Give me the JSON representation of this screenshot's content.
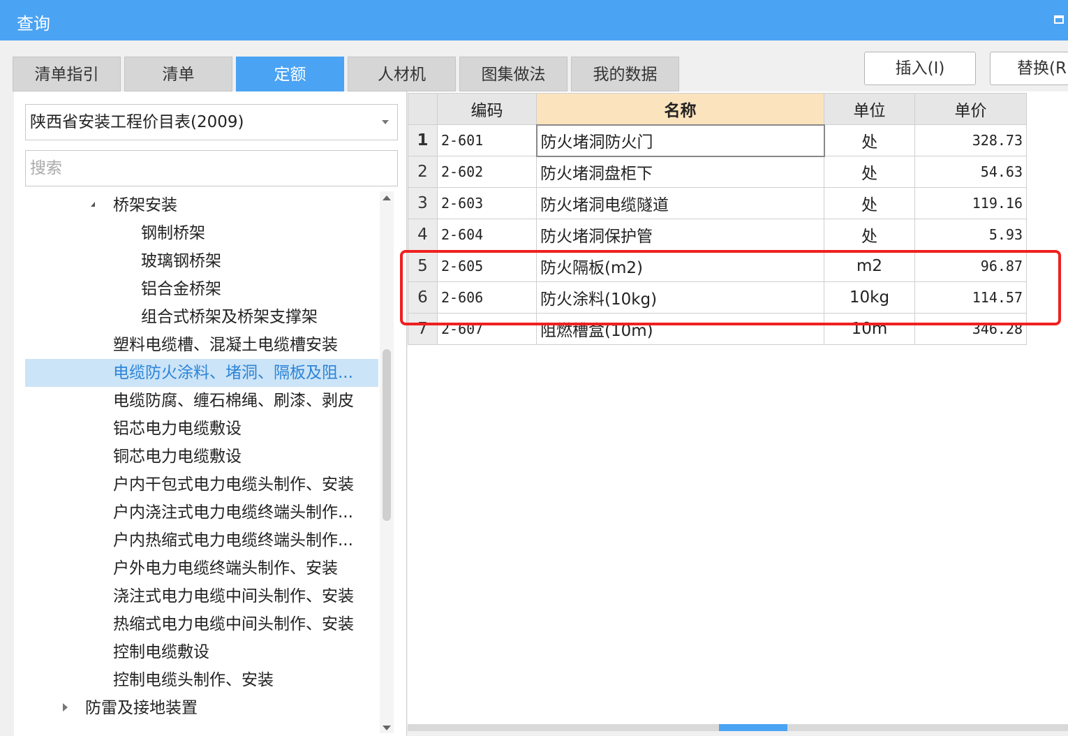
{
  "window": {
    "title": "查询"
  },
  "tabs": [
    "清单指引",
    "清单",
    "定额",
    "人材机",
    "图集做法",
    "我的数据"
  ],
  "active_tab": "定额",
  "actions": {
    "insert_label": "插入(I)",
    "replace_label": "替换(R"
  },
  "left": {
    "library": "陕西省安装工程价目表(2009)",
    "search_placeholder": "搜索",
    "tree": [
      "桥架安装",
      "钢制桥架",
      "玻璃钢桥架",
      "铝合金桥架",
      "组合式桥架及桥架支撑架",
      "塑料电缆槽、混凝土电缆槽安装",
      "电缆防火涂料、堵洞、隔板及阻...",
      "电缆防腐、缠石棉绳、刷漆、剥皮",
      "铝芯电力电缆敷设",
      "铜芯电力电缆敷设",
      "户内干包式电力电缆头制作、安装",
      "户内浇注式电力电缆终端头制作...",
      "户内热缩式电力电缆终端头制作...",
      "户外电力电缆终端头制作、安装",
      "浇注式电力电缆中间头制作、安装",
      "热缩式电力电缆中间头制作、安装",
      "控制电缆敷设",
      "控制电缆头制作、安装",
      "防雷及接地装置"
    ]
  },
  "grid": {
    "headers": {
      "code": "编码",
      "name": "名称",
      "unit": "单位",
      "price": "单价"
    },
    "rows": [
      {
        "no": "1",
        "code": "2-601",
        "name": "防火堵洞防火门",
        "unit": "处",
        "price": "328.73"
      },
      {
        "no": "2",
        "code": "2-602",
        "name": "防火堵洞盘柜下",
        "unit": "处",
        "price": "54.63"
      },
      {
        "no": "3",
        "code": "2-603",
        "name": "防火堵洞电缆隧道",
        "unit": "处",
        "price": "119.16"
      },
      {
        "no": "4",
        "code": "2-604",
        "name": "防火堵洞保护管",
        "unit": "处",
        "price": "5.93"
      },
      {
        "no": "5",
        "code": "2-605",
        "name": "防火隔板(m2)",
        "unit": "m2",
        "price": "96.87"
      },
      {
        "no": "6",
        "code": "2-606",
        "name": "防火涂料(10kg)",
        "unit": "10kg",
        "price": "114.57"
      },
      {
        "no": "7",
        "code": "2-607",
        "name": "阻燃槽盒(10m)",
        "unit": "10m",
        "price": "346.28"
      }
    ]
  },
  "colors": {
    "accent": "#4ba3f3",
    "highlight": "#f02020",
    "selected_bg": "#cce4f7",
    "sorted_header": "#fbe3bd"
  }
}
